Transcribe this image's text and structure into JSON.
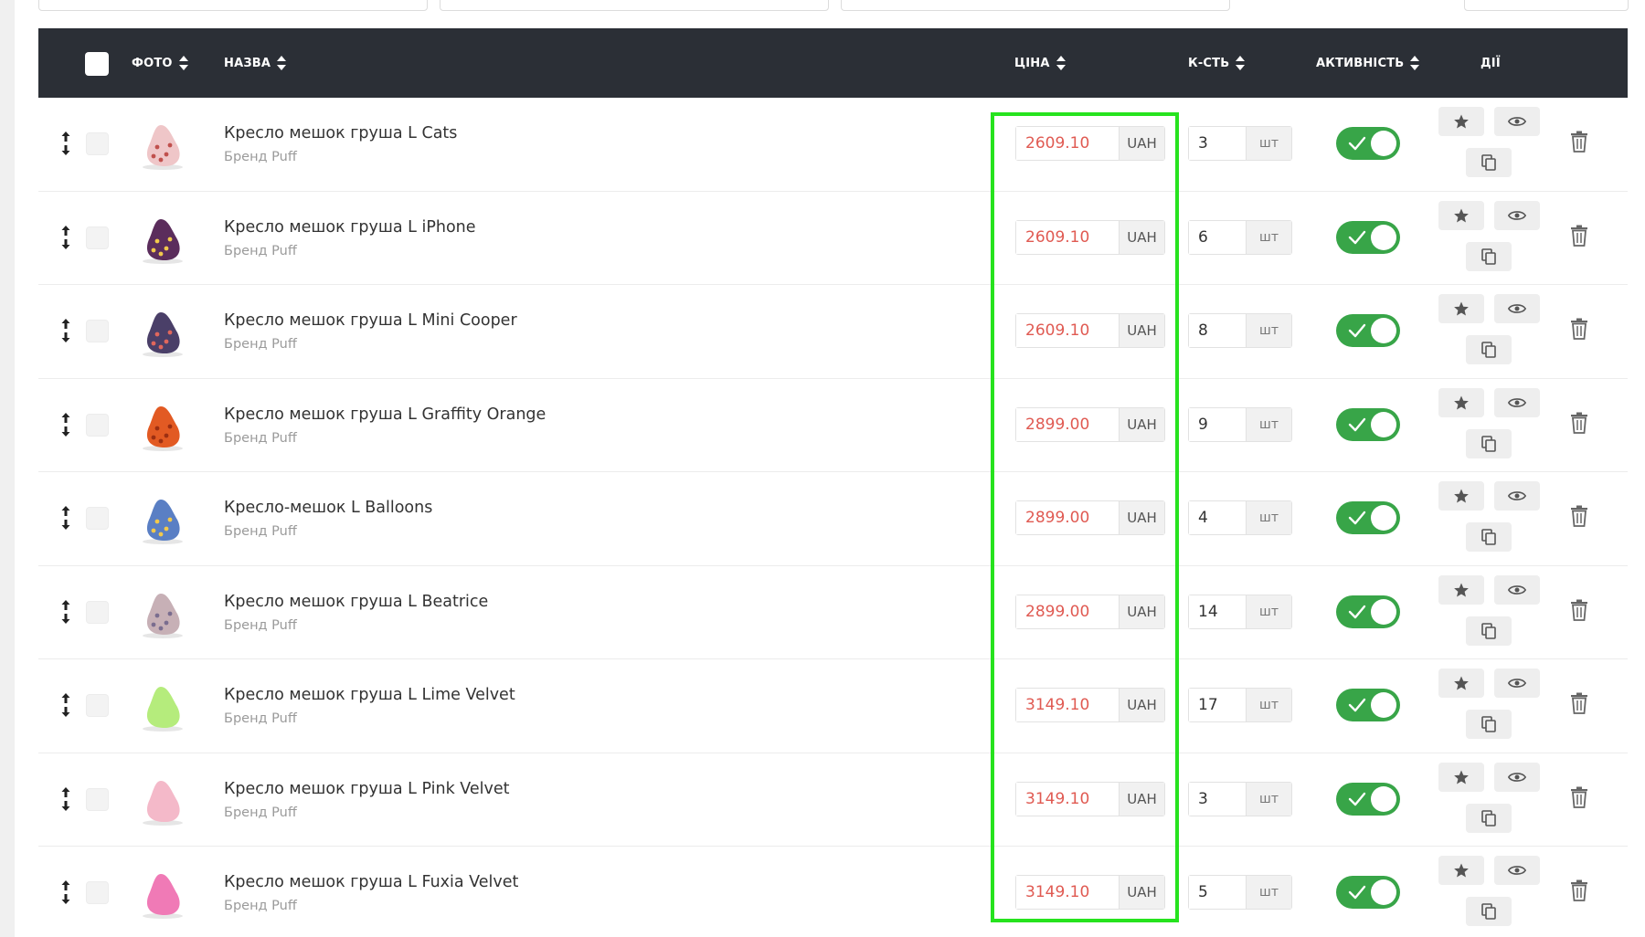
{
  "header": {
    "photo_label": "ФОТО",
    "name_label": "НАЗВА",
    "price_label": "ЦІНА",
    "qty_label": "К-СТЬ",
    "activity_label": "АКТИВНІСТЬ",
    "actions_label": "ДІЇ"
  },
  "colors": {
    "header_bg": "#2b2f36",
    "price_text": "#e05a52",
    "toggle_on": "#38a548",
    "highlight": "#26e31e"
  },
  "products": [
    {
      "name": "Кресло мешок груша L Cats",
      "brand": "Бренд Puff",
      "price": "2609.10",
      "currency": "UAH",
      "qty": "3",
      "unit": "шт",
      "active": true,
      "thumb_color": "#efc6c8",
      "thumb_dots": "#c0504d"
    },
    {
      "name": "Кресло мешок груша L iPhone",
      "brand": "Бренд Puff",
      "price": "2609.10",
      "currency": "UAH",
      "qty": "6",
      "unit": "шт",
      "active": true,
      "thumb_color": "#5b2d5c",
      "thumb_dots": "#f2c94c"
    },
    {
      "name": "Кресло мешок груша L Mini Cooper",
      "brand": "Бренд Puff",
      "price": "2609.10",
      "currency": "UAH",
      "qty": "8",
      "unit": "шт",
      "active": true,
      "thumb_color": "#4a3f68",
      "thumb_dots": "#e0675c"
    },
    {
      "name": "Кресло мешок груша L Graffity Orange",
      "brand": "Бренд Puff",
      "price": "2899.00",
      "currency": "UAH",
      "qty": "9",
      "unit": "шт",
      "active": true,
      "thumb_color": "#e25a23",
      "thumb_dots": "#9c2f12"
    },
    {
      "name": "Кресло-мешок L Balloons",
      "brand": "Бренд Puff",
      "price": "2899.00",
      "currency": "UAH",
      "qty": "4",
      "unit": "шт",
      "active": true,
      "thumb_color": "#5a7fc4",
      "thumb_dots": "#f2c94c"
    },
    {
      "name": "Кресло мешок груша L Beatrice",
      "brand": "Бренд Puff",
      "price": "2899.00",
      "currency": "UAH",
      "qty": "14",
      "unit": "шт",
      "active": true,
      "thumb_color": "#c7b0b6",
      "thumb_dots": "#7a6d8f"
    },
    {
      "name": "Кресло мешок груша L Lime Velvet",
      "brand": "Бренд Puff",
      "price": "3149.10",
      "currency": "UAH",
      "qty": "17",
      "unit": "шт",
      "active": true,
      "thumb_color": "#b5ec7c",
      "thumb_dots": "#b5ec7c"
    },
    {
      "name": "Кресло мешок груша L Pink Velvet",
      "brand": "Бренд Puff",
      "price": "3149.10",
      "currency": "UAH",
      "qty": "3",
      "unit": "шт",
      "active": true,
      "thumb_color": "#f4b9c9",
      "thumb_dots": "#f4b9c9"
    },
    {
      "name": "Кресло мешок груша L Fuxia Velvet",
      "brand": "Бренд Puff",
      "price": "3149.10",
      "currency": "UAH",
      "qty": "5",
      "unit": "шт",
      "active": true,
      "thumb_color": "#f07ab6",
      "thumb_dots": "#f07ab6"
    }
  ]
}
